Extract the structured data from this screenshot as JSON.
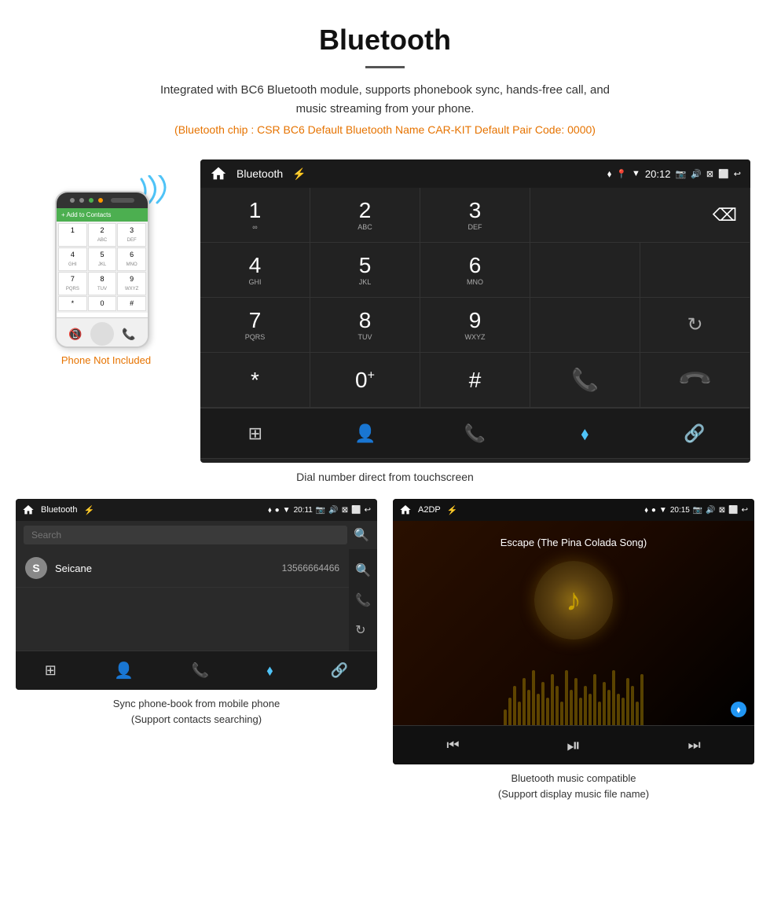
{
  "header": {
    "title": "Bluetooth",
    "description": "Integrated with BC6 Bluetooth module, supports phonebook sync, hands-free call, and music streaming from your phone.",
    "specs": "(Bluetooth chip : CSR BC6    Default Bluetooth Name CAR-KIT    Default Pair Code: 0000)"
  },
  "phone_label": "Phone Not Included",
  "car_unit": {
    "status_bar": {
      "title": "Bluetooth",
      "time": "20:12"
    },
    "dialpad": {
      "keys": [
        {
          "number": "1",
          "letters": "∞"
        },
        {
          "number": "2",
          "letters": "ABC"
        },
        {
          "number": "3",
          "letters": "DEF"
        },
        {
          "number": "4",
          "letters": "GHI"
        },
        {
          "number": "5",
          "letters": "JKL"
        },
        {
          "number": "6",
          "letters": "MNO"
        },
        {
          "number": "7",
          "letters": "PQRS"
        },
        {
          "number": "8",
          "letters": "TUV"
        },
        {
          "number": "9",
          "letters": "WXYZ"
        },
        {
          "number": "*",
          "letters": ""
        },
        {
          "number": "0",
          "letters": "+"
        },
        {
          "number": "#",
          "letters": ""
        }
      ]
    }
  },
  "main_caption": "Dial number direct from touchscreen",
  "phonebook": {
    "status_bar": {
      "title": "Bluetooth",
      "time": "20:11"
    },
    "search_placeholder": "Search",
    "contact": {
      "initial": "S",
      "name": "Seicane",
      "number": "13566664466"
    },
    "caption": "Sync phone-book from mobile phone\n(Support contacts searching)"
  },
  "music": {
    "status_bar": {
      "title": "A2DP",
      "time": "20:15"
    },
    "song_title": "Escape (The Pina Colada Song)",
    "icon": "♪",
    "caption": "Bluetooth music compatible\n(Support display music file name)"
  },
  "eq_bars_heights": [
    20,
    35,
    50,
    30,
    60,
    45,
    70,
    40,
    55,
    35,
    65,
    50,
    30,
    70,
    45,
    60,
    35,
    50,
    40,
    65,
    30,
    55,
    45,
    70,
    40,
    35,
    60,
    50,
    30,
    65
  ]
}
